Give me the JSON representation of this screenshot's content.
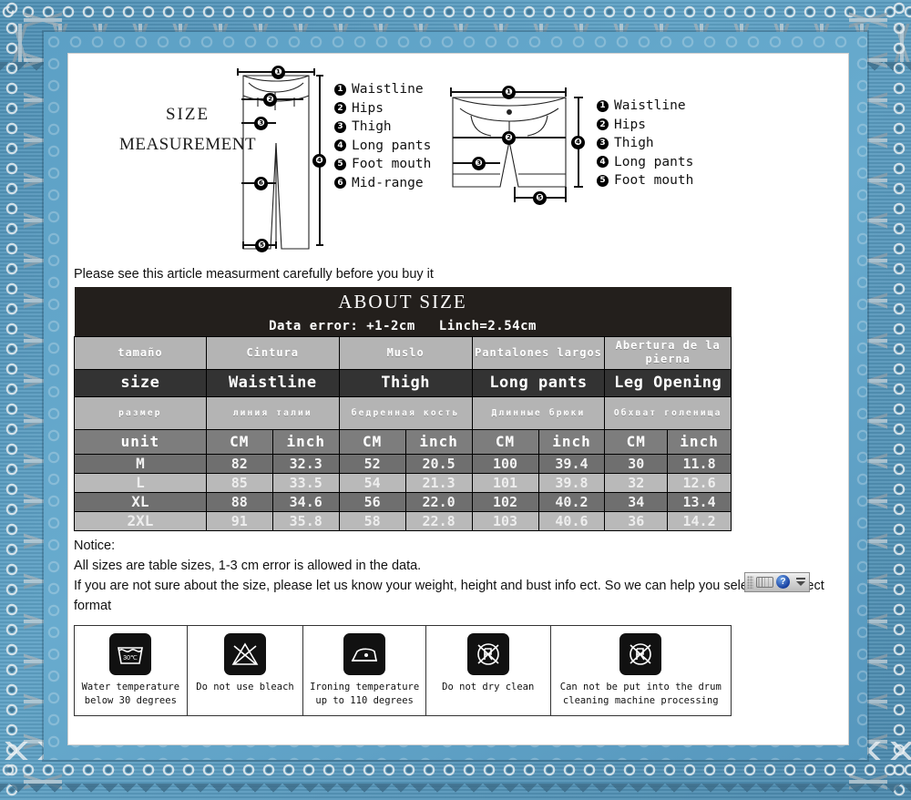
{
  "header": {
    "title_line1": "SIZE",
    "title_line2": "MEASUREMENT"
  },
  "legend_left": [
    {
      "num": "1",
      "label": "Waistline"
    },
    {
      "num": "2",
      "label": "Hips"
    },
    {
      "num": "3",
      "label": "Thigh"
    },
    {
      "num": "4",
      "label": "Long pants"
    },
    {
      "num": "5",
      "label": "Foot mouth"
    },
    {
      "num": "6",
      "label": "Mid-range"
    }
  ],
  "legend_right": [
    {
      "num": "1",
      "label": "Waistline"
    },
    {
      "num": "2",
      "label": "Hips"
    },
    {
      "num": "3",
      "label": "Thigh"
    },
    {
      "num": "4",
      "label": "Long pants"
    },
    {
      "num": "5",
      "label": "Foot mouth"
    }
  ],
  "please_line": "Please see this article measurment carefully before you buy it",
  "table": {
    "banner": "ABOUT SIZE",
    "sub_left": "Data error: +1-2cm",
    "sub_right": "Linch=2.54cm",
    "header_es": [
      "tamaño",
      "Cintura",
      "Muslo",
      "Pantalones largos",
      "Abertura de la pierna"
    ],
    "header_en": [
      "size",
      "Waistline",
      "Thigh",
      "Long pants",
      "Leg Opening"
    ],
    "header_ru": [
      "размер",
      "линия талии",
      "бедренная кость",
      "Длинные брюки",
      "Обхват голенища"
    ],
    "unit_row": [
      "unit",
      "CM",
      "inch",
      "CM",
      "inch",
      "CM",
      "inch",
      "CM",
      "inch"
    ],
    "rows": [
      {
        "size": "M",
        "values": [
          "82",
          "32.3",
          "52",
          "20.5",
          "100",
          "39.4",
          "30",
          "11.8"
        ]
      },
      {
        "size": "L",
        "values": [
          "85",
          "33.5",
          "54",
          "21.3",
          "101",
          "39.8",
          "32",
          "12.6"
        ]
      },
      {
        "size": "XL",
        "values": [
          "88",
          "34.6",
          "56",
          "22.0",
          "102",
          "40.2",
          "34",
          "13.4"
        ]
      },
      {
        "size": "2XL",
        "values": [
          "91",
          "35.8",
          "58",
          "22.8",
          "103",
          "40.6",
          "36",
          "14.2"
        ]
      }
    ]
  },
  "notice": {
    "title": "Notice:",
    "line1": " All sizes are table sizes, 1-3 cm error is allowed in the data.",
    "line2": "If you are not sure about the size, please let us know your weight, height and bust info ect. So we can help you select the correct format"
  },
  "ime": {
    "help_glyph": "?"
  },
  "care": [
    {
      "icon": "wash-30-icon",
      "temp": "30℃",
      "label": "Water temperature\nbelow 30 degrees"
    },
    {
      "icon": "no-bleach-icon",
      "label": "Do not use bleach"
    },
    {
      "icon": "iron-icon",
      "label": "Ironing temperature\nup to 110 degrees"
    },
    {
      "icon": "no-dry-clean-icon",
      "label": "Do not dry clean"
    },
    {
      "icon": "no-tumble-dry-icon",
      "label": "Can not be put into the drum\ncleaning machine processing"
    }
  ],
  "colors": {
    "frame_blue": "#5696bc",
    "banner_dark": "#231f1c",
    "header_en_bg": "#333333",
    "header_alt_bg": "#b4b4b4",
    "unit_bg": "#7d7d7d",
    "row_dark": "#6f6f6f",
    "row_light": "#b9b9b9"
  }
}
